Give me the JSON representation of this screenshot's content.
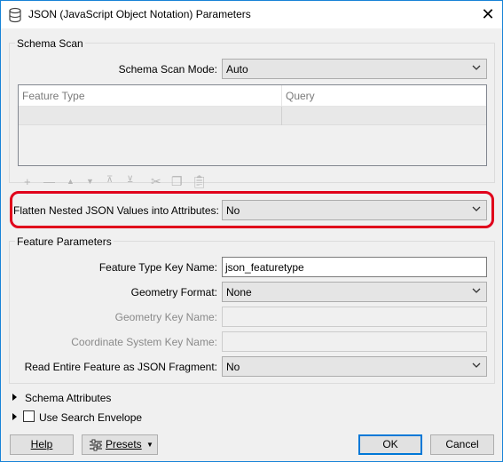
{
  "window": {
    "title": "JSON (JavaScript Object Notation) Parameters",
    "icons": {
      "app": "database-icon",
      "close": "close-icon"
    }
  },
  "schema_scan": {
    "group_label": "Schema Scan",
    "mode_label": "Schema Scan Mode:",
    "mode_value": "Auto",
    "table": {
      "columns": [
        "Feature Type",
        "Query"
      ],
      "rows": [
        [
          "",
          ""
        ]
      ]
    },
    "toolbar_icons": [
      "add-icon",
      "remove-icon",
      "move-up-icon",
      "move-down-icon",
      "move-top-icon",
      "move-bottom-icon",
      "cut-icon",
      "copy-icon",
      "paste-icon"
    ]
  },
  "flatten": {
    "label": "Flatten Nested JSON Values into Attributes:",
    "value": "No"
  },
  "feature_parameters": {
    "group_label": "Feature Parameters",
    "feature_type_key_label": "Feature Type Key Name:",
    "feature_type_key_value": "json_featuretype",
    "geometry_format_label": "Geometry Format:",
    "geometry_format_value": "None",
    "geometry_key_label": "Geometry Key Name:",
    "geometry_key_value": "",
    "coord_sys_key_label": "Coordinate System Key Name:",
    "coord_sys_key_value": "",
    "read_entire_label": "Read Entire Feature as JSON Fragment:",
    "read_entire_value": "No"
  },
  "schema_attributes": {
    "label": "Schema Attributes"
  },
  "search_envelope": {
    "label": "Use Search Envelope",
    "checked": false
  },
  "buttons": {
    "help": "Help",
    "presets": "Presets",
    "ok": "OK",
    "cancel": "Cancel"
  },
  "colors": {
    "highlight": "#e0001b",
    "accent": "#0078d7"
  }
}
